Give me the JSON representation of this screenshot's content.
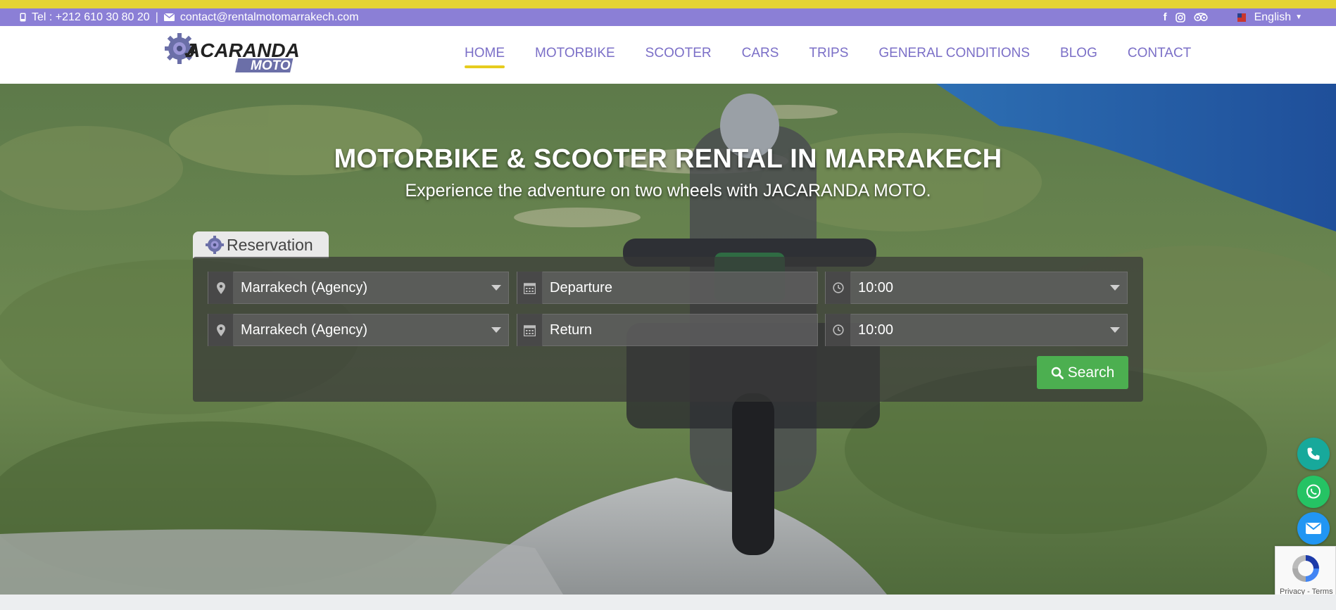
{
  "topbar": {
    "phone_text": "Tel : +212 610 30 80 20",
    "separator": "|",
    "email_text": "contact@rentalmotomarrakech.com",
    "language": "English",
    "social_icons": [
      "facebook-icon",
      "instagram-icon",
      "tripadvisor-icon"
    ]
  },
  "brand": {
    "name_line1": "JACARANDA",
    "name_line2": "MOTO",
    "accent_color": "#8b7fd6",
    "highlight_color": "#e6cc1e"
  },
  "nav": {
    "items": [
      {
        "label": "HOME",
        "active": true
      },
      {
        "label": "MOTORBIKE"
      },
      {
        "label": "SCOOTER"
      },
      {
        "label": "CARS"
      },
      {
        "label": "TRIPS"
      },
      {
        "label": "GENERAL CONDITIONS"
      },
      {
        "label": "BLOG"
      },
      {
        "label": "CONTACT"
      }
    ]
  },
  "hero": {
    "title": "MOTORBIKE & SCOOTER RENTAL IN MARRAKECH",
    "subtitle": "Experience the adventure on two wheels with JACARANDA MOTO."
  },
  "reservation": {
    "tab_label": "Reservation",
    "pickup_location": "Marrakech (Agency)",
    "departure_placeholder": "Departure",
    "departure_time": "10:00",
    "return_location": "Marrakech (Agency)",
    "return_placeholder": "Return",
    "return_time": "10:00",
    "search_label": "Search",
    "search_color": "#4caf50"
  },
  "floating": {
    "icons": [
      "phone-icon",
      "whatsapp-icon",
      "mail-icon"
    ]
  },
  "recaptcha": {
    "terms": "Privacy - Terms"
  }
}
